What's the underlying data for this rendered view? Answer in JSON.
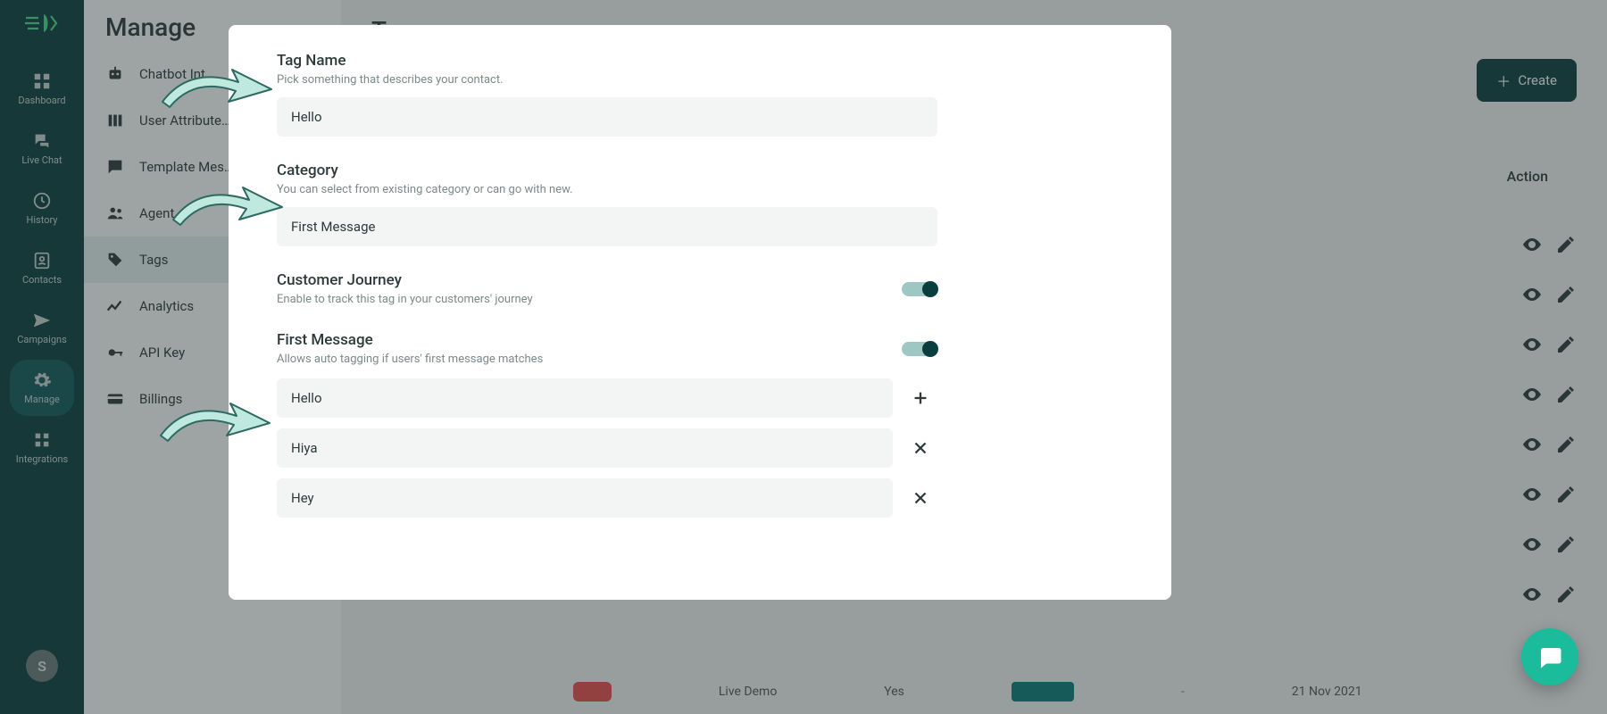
{
  "rail": {
    "items": [
      {
        "label": "Dashboard"
      },
      {
        "label": "Live Chat"
      },
      {
        "label": "History"
      },
      {
        "label": "Contacts"
      },
      {
        "label": "Campaigns"
      },
      {
        "label": "Manage"
      },
      {
        "label": "Integrations"
      }
    ],
    "avatar_initial": "S"
  },
  "sidebar": {
    "title": "Manage",
    "items": [
      {
        "label": "Chatbot Int…"
      },
      {
        "label": "User Attribute…"
      },
      {
        "label": "Template Mes…"
      },
      {
        "label": "Agent…"
      },
      {
        "label": "Tags"
      },
      {
        "label": "Analytics"
      },
      {
        "label": "API Key"
      },
      {
        "label": "Billings"
      }
    ]
  },
  "page": {
    "title": "Tags",
    "create_label": "Create",
    "action_header": "Action"
  },
  "hidden": {
    "live_demo": "Live Demo",
    "yes": "Yes",
    "dash": "-",
    "date": "21 Nov 2021"
  },
  "dialog": {
    "tag_name": {
      "title": "Tag Name",
      "desc": "Pick something that describes your contact.",
      "value": "Hello"
    },
    "category": {
      "title": "Category",
      "desc": "You can select from existing category or can go with new.",
      "value": "First Message"
    },
    "journey": {
      "title": "Customer Journey",
      "desc": "Enable to track this tag in your customers' journey",
      "enabled": true
    },
    "first_message": {
      "title": "First Message",
      "desc": "Allows auto tagging if users' first message matches",
      "enabled": true
    },
    "messages": [
      {
        "value": "Hello",
        "action": "add"
      },
      {
        "value": "Hiya",
        "action": "remove"
      },
      {
        "value": "Hey",
        "action": "remove"
      }
    ]
  }
}
